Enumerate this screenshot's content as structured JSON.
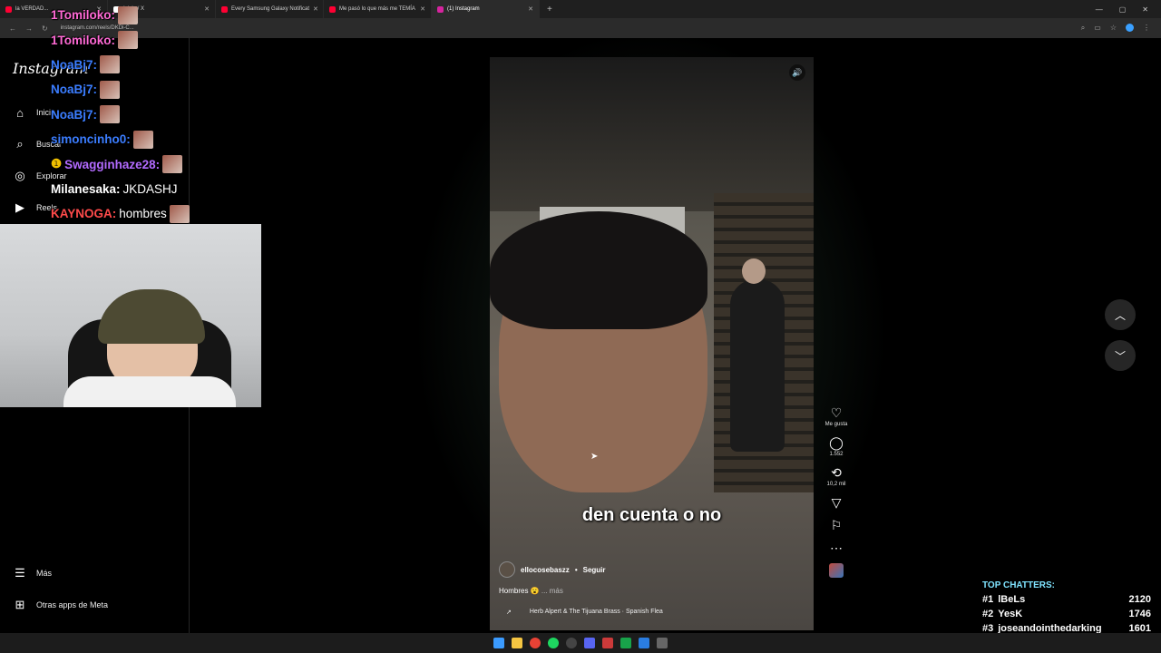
{
  "browser": {
    "tabs": [
      {
        "label": "la VERDAD...",
        "color": "#ff0033"
      },
      {
        "label": "Inicio / X",
        "color": "#ffffff"
      },
      {
        "label": "Every Samsung Galaxy Notificat",
        "color": "#ff0033"
      },
      {
        "label": "Me pasó lo que más me TEMÍA",
        "color": "#ff0033"
      },
      {
        "label": "(1) Instagram",
        "color": "#d6249f"
      }
    ],
    "url": "instagram.com/reels/DKDi-C..."
  },
  "sidebar": {
    "logo": "Instagram",
    "items": [
      {
        "label": "Inicio",
        "icon": "home-icon",
        "glyph": "⌂"
      },
      {
        "label": "Buscar",
        "icon": "search-icon",
        "glyph": "⌕"
      },
      {
        "label": "Explorar",
        "icon": "compass-icon",
        "glyph": "◎"
      },
      {
        "label": "Reels",
        "icon": "reels-icon",
        "glyph": "▶"
      }
    ],
    "more": "Más",
    "meta_apps": "Otras apps de Meta"
  },
  "reel": {
    "subtitle": "den cuenta o no",
    "author": "ellocosebaszz",
    "follow": "Seguir",
    "caption": "Hombres 😮",
    "caption_more": "... más",
    "audio": "Herb Alpert & The Tijuana Brass · Spanish Flea"
  },
  "actions": {
    "like": "Me gusta",
    "comments": "1.552",
    "reposts": "10,2 mil"
  },
  "chat": [
    {
      "user": "1Tomiloko:",
      "msg": "",
      "color": "#ff6ad5"
    },
    {
      "user": "1Tomiloko:",
      "msg": "",
      "color": "#ff6ad5"
    },
    {
      "user": "NoaBj7:",
      "msg": "",
      "color": "#3b7dff"
    },
    {
      "user": "NoaBj7:",
      "msg": "",
      "color": "#3b7dff"
    },
    {
      "user": "NoaBj7:",
      "msg": "",
      "color": "#3b7dff"
    },
    {
      "user": "simoncinho0:",
      "msg": "",
      "color": "#3b7dff"
    },
    {
      "user": "Swagginhaze28:",
      "msg": "",
      "color": "#b36bff"
    },
    {
      "user": "Milanesaka:",
      "msg": "JKDASHJ",
      "color": "#ffffff"
    },
    {
      "user": "KAYNOGA:",
      "msg": "hombres",
      "color": "#ff4b4b"
    }
  ],
  "top_chatters": {
    "title": "TOP CHATTERS:",
    "rows": [
      {
        "rank": "#1",
        "name": "lBeLs",
        "count": "2120"
      },
      {
        "rank": "#2",
        "name": "YesK",
        "count": "1746"
      },
      {
        "rank": "#3",
        "name": "joseandointhedarking",
        "count": "1601"
      }
    ]
  }
}
